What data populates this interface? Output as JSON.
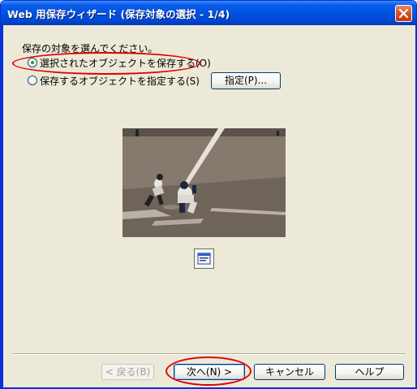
{
  "window": {
    "title": "Web 用保存ウィザード (保存対象の選択 - 1/4)"
  },
  "content": {
    "instruction": "保存の対象を選んでください。",
    "options": [
      {
        "label": "選択されたオブジェクトを保存する(O)",
        "selected": true
      },
      {
        "label": "保存するオブジェクトを指定する(S)",
        "selected": false
      }
    ],
    "specify_button": "指定(P)...",
    "preview": {
      "description": "baseball play at home plate",
      "icon": "text-box-icon"
    }
  },
  "footer": {
    "back": "< 戻る(B)",
    "next": "次へ(N) >",
    "cancel": "キャンセル",
    "help": "ヘルプ"
  },
  "colors": {
    "accent": "#0054e3",
    "highlight_oval": "#e00000",
    "radio_dot": "#21a121"
  }
}
